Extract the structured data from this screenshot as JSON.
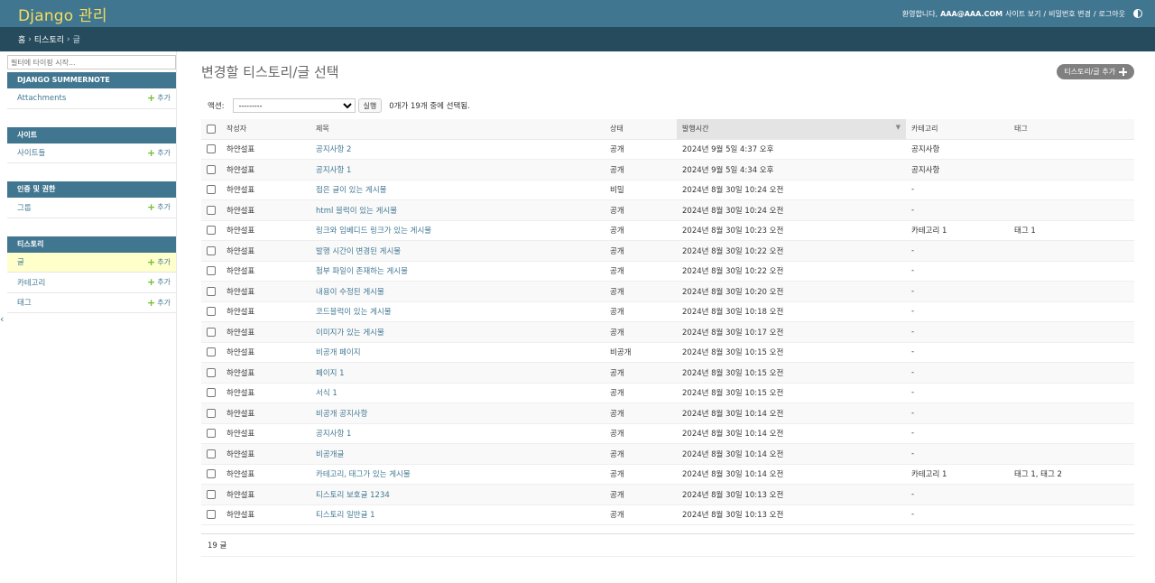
{
  "header": {
    "branding": "Django 관리",
    "welcome": "환영합니다,",
    "username": "AAA@AAA.COM",
    "view_site": "사이트 보기",
    "change_password": "비밀번호 변경",
    "logout": "로그아웃",
    "sep": "/"
  },
  "breadcrumbs": {
    "home": "홈",
    "app": "티스토리",
    "model": "글",
    "sep": "›"
  },
  "sidebar": {
    "filter_placeholder": "필터에 타이핑 시작...",
    "add_label": "추가",
    "modules": [
      {
        "caption": "Django Summernote",
        "items": [
          {
            "label": "Attachments"
          }
        ]
      },
      {
        "caption": "사이트",
        "items": [
          {
            "label": "사이트들"
          }
        ]
      },
      {
        "caption": "인증 및 권한",
        "items": [
          {
            "label": "그룹"
          }
        ]
      },
      {
        "caption": "티스토리",
        "items": [
          {
            "label": "글"
          },
          {
            "label": "카테고리"
          },
          {
            "label": "태그"
          }
        ]
      }
    ]
  },
  "content": {
    "title": "변경할 티스토리/글 선택",
    "add_button": "티스토리/글 추가",
    "actions_label": "액션:",
    "action_select_value": "---------",
    "go_button": "실행",
    "counter": "0개가 19개 중에 선택됨.",
    "columns": [
      "작성자",
      "제목",
      "상태",
      "발행시간",
      "카테고리",
      "태그"
    ],
    "rows": [
      [
        "하얀설표",
        "공지사항 2",
        "공개",
        "2024년 9월 5일 4:37 오후",
        "공지사항",
        ""
      ],
      [
        "하얀설표",
        "공지사항 1",
        "공개",
        "2024년 9월 5일 4:34 오후",
        "공지사항",
        ""
      ],
      [
        "하얀설표",
        "접은 글이 있는 게시물",
        "비밀",
        "2024년 8월 30일 10:24 오전",
        "-",
        ""
      ],
      [
        "하얀설표",
        "html 블럭이 있는 게시물",
        "공개",
        "2024년 8월 30일 10:24 오전",
        "-",
        ""
      ],
      [
        "하얀설표",
        "링크와 임베디드 링크가 있는 게시물",
        "공개",
        "2024년 8월 30일 10:23 오전",
        "카테고리 1",
        "태그 1"
      ],
      [
        "하얀설표",
        "발행 시간이 변경된 게시물",
        "공개",
        "2024년 8월 30일 10:22 오전",
        "-",
        ""
      ],
      [
        "하얀설표",
        "첨부 파일이 존재하는 게시물",
        "공개",
        "2024년 8월 30일 10:22 오전",
        "-",
        ""
      ],
      [
        "하얀설표",
        "내용이 수정된 게시물",
        "공개",
        "2024년 8월 30일 10:20 오전",
        "-",
        ""
      ],
      [
        "하얀설표",
        "코드블럭이 있는 게시물",
        "공개",
        "2024년 8월 30일 10:18 오전",
        "-",
        ""
      ],
      [
        "하얀설표",
        "이미지가 있는 게시물",
        "공개",
        "2024년 8월 30일 10:17 오전",
        "-",
        ""
      ],
      [
        "하얀설표",
        "비공개 페이지",
        "비공개",
        "2024년 8월 30일 10:15 오전",
        "-",
        ""
      ],
      [
        "하얀설표",
        "페이지 1",
        "공개",
        "2024년 8월 30일 10:15 오전",
        "-",
        ""
      ],
      [
        "하얀설표",
        "서식 1",
        "공개",
        "2024년 8월 30일 10:15 오전",
        "-",
        ""
      ],
      [
        "하얀설표",
        "비공개 공지사항",
        "공개",
        "2024년 8월 30일 10:14 오전",
        "-",
        ""
      ],
      [
        "하얀설표",
        "공지사항 1",
        "공개",
        "2024년 8월 30일 10:14 오전",
        "-",
        ""
      ],
      [
        "하얀설표",
        "비공개글",
        "공개",
        "2024년 8월 30일 10:14 오전",
        "-",
        ""
      ],
      [
        "하얀설표",
        "카테고리, 태그가 있는 게시물",
        "공개",
        "2024년 8월 30일 10:14 오전",
        "카테고리 1",
        "태그 1, 태그 2"
      ],
      [
        "하얀설표",
        "티스토리 보호글 1234",
        "공개",
        "2024년 8월 30일 10:13 오전",
        "-",
        ""
      ],
      [
        "하얀설표",
        "티스토리 일반글 1",
        "공개",
        "2024년 8월 30일 10:13 오전",
        "-",
        ""
      ]
    ],
    "paginator": "19 글"
  },
  "colors": {
    "header": "#417690",
    "breadcrumbs": "#264b5d",
    "branding": "#f5dd5d",
    "link": "#417893",
    "current_row": "#ffffcc",
    "add_plus": "#70bf2b"
  }
}
